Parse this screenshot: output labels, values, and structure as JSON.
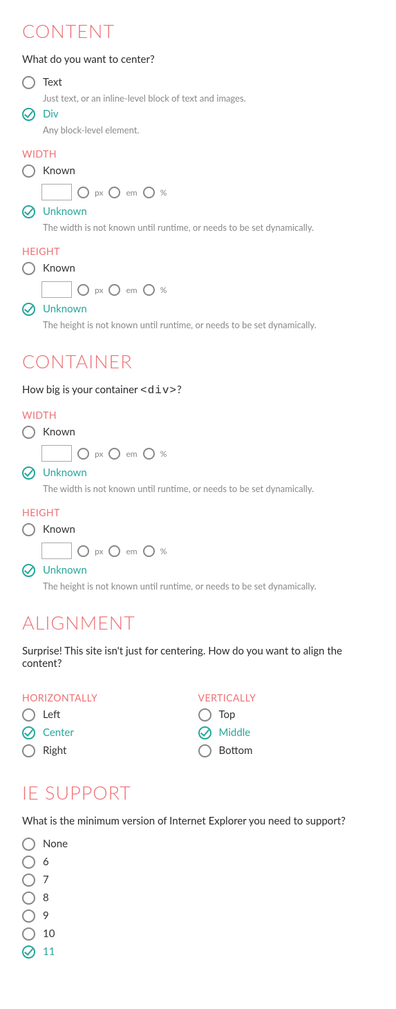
{
  "content": {
    "heading": "CONTENT",
    "question": "What do you want to center?",
    "options": [
      {
        "label": "Text",
        "desc": "Just text, or an inline-level block of text and images.",
        "selected": false
      },
      {
        "label": "Div",
        "desc": "Any block-level element.",
        "selected": true
      }
    ]
  },
  "units": {
    "px": "px",
    "em": "em",
    "pct": "%"
  },
  "content_width": {
    "heading": "WIDTH",
    "known": {
      "label": "Known",
      "selected": false
    },
    "unknown": {
      "label": "Unknown",
      "desc": "The width is not known until runtime, or needs to be set dynamically.",
      "selected": true
    }
  },
  "content_height": {
    "heading": "HEIGHT",
    "known": {
      "label": "Known",
      "selected": false
    },
    "unknown": {
      "label": "Unknown",
      "desc": "The height is not known until runtime, or needs to be set dynamically.",
      "selected": true
    }
  },
  "container": {
    "heading": "CONTAINER",
    "question_pre": "How big is your container ",
    "question_code": "<div>",
    "question_post": "?"
  },
  "container_width": {
    "heading": "WIDTH",
    "known": {
      "label": "Known",
      "selected": false
    },
    "unknown": {
      "label": "Unknown",
      "desc": "The width is not known until runtime, or needs to be set dynamically.",
      "selected": true
    }
  },
  "container_height": {
    "heading": "HEIGHT",
    "known": {
      "label": "Known",
      "selected": false
    },
    "unknown": {
      "label": "Unknown",
      "desc": "The height is not known until runtime, or needs to be set dynamically.",
      "selected": true
    }
  },
  "alignment": {
    "heading": "ALIGNMENT",
    "question": "Surprise! This site isn't just for centering. How do you want to align the content?",
    "horizontal": {
      "heading": "HORIZONTALLY",
      "options": [
        {
          "label": "Left",
          "selected": false
        },
        {
          "label": "Center",
          "selected": true
        },
        {
          "label": "Right",
          "selected": false
        }
      ]
    },
    "vertical": {
      "heading": "VERTICALLY",
      "options": [
        {
          "label": "Top",
          "selected": false
        },
        {
          "label": "Middle",
          "selected": true
        },
        {
          "label": "Bottom",
          "selected": false
        }
      ]
    }
  },
  "ie": {
    "heading": "IE SUPPORT",
    "question": "What is the minimum version of Internet Explorer you need to support?",
    "options": [
      {
        "label": "None",
        "selected": false
      },
      {
        "label": "6",
        "selected": false
      },
      {
        "label": "7",
        "selected": false
      },
      {
        "label": "8",
        "selected": false
      },
      {
        "label": "9",
        "selected": false
      },
      {
        "label": "10",
        "selected": false
      },
      {
        "label": "11",
        "selected": true
      }
    ]
  }
}
